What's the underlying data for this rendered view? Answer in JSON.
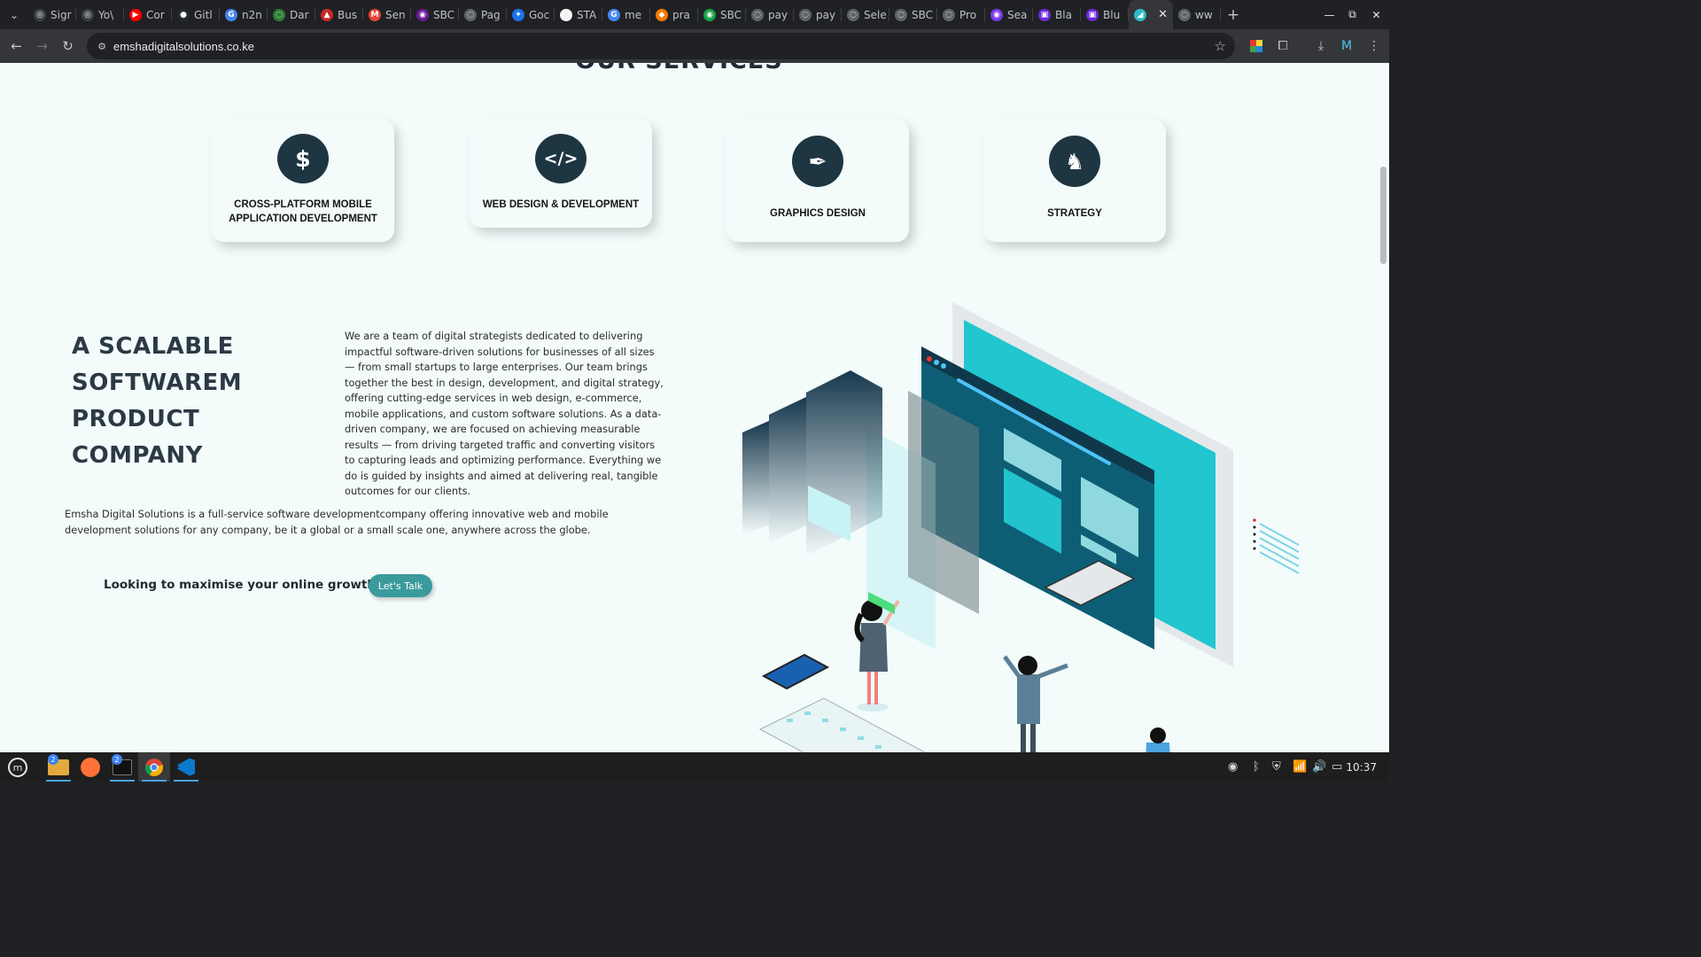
{
  "browser": {
    "tabs": [
      {
        "label": "Sigr",
        "icon": "chatgpt-icon",
        "color": "#3c4043",
        "glyph": "◎"
      },
      {
        "label": "Yo\\",
        "icon": "openai-icon",
        "color": "#3c4043",
        "glyph": "◎"
      },
      {
        "label": "Cor",
        "icon": "youtube-icon",
        "color": "#ff0000",
        "glyph": "▶"
      },
      {
        "label": "Gitl",
        "icon": "github-icon",
        "color": "#24292e",
        "glyph": "●"
      },
      {
        "label": "n2n",
        "icon": "google-icon",
        "color": "#4285f4",
        "glyph": "G"
      },
      {
        "label": "Dar",
        "icon": "daraja-icon",
        "color": "#2e7d32",
        "glyph": "◌"
      },
      {
        "label": "Bus",
        "icon": "business-icon",
        "color": "#c62828",
        "glyph": "▲"
      },
      {
        "label": "Sen",
        "icon": "gmail-icon",
        "color": "#ea4335",
        "glyph": "M"
      },
      {
        "label": "SBC",
        "icon": "sbc-icon",
        "color": "#6a1b9a",
        "glyph": "◉"
      },
      {
        "label": "Pag",
        "icon": "globe-icon",
        "color": "#5f6368",
        "glyph": "◌"
      },
      {
        "label": "Goc",
        "icon": "gemini-icon",
        "color": "#1a73e8",
        "glyph": "✦"
      },
      {
        "label": "STA",
        "icon": "sta-icon",
        "color": "#f5f5f5",
        "glyph": "◌"
      },
      {
        "label": "me",
        "icon": "google-icon",
        "color": "#4285f4",
        "glyph": "G"
      },
      {
        "label": "pra",
        "icon": "brave-icon",
        "color": "#f57c00",
        "glyph": "◆"
      },
      {
        "label": "SBC",
        "icon": "sbc-green-icon",
        "color": "#16a34a",
        "glyph": "◉"
      },
      {
        "label": "pay",
        "icon": "globe-icon",
        "color": "#5f6368",
        "glyph": "◌"
      },
      {
        "label": "pay",
        "icon": "globe-icon",
        "color": "#5f6368",
        "glyph": "◌"
      },
      {
        "label": "Sele",
        "icon": "globe-icon",
        "color": "#5f6368",
        "glyph": "◌"
      },
      {
        "label": "SBC",
        "icon": "globe-icon",
        "color": "#5f6368",
        "glyph": "◌"
      },
      {
        "label": "Pro",
        "icon": "globe-icon",
        "color": "#5f6368",
        "glyph": "◌"
      },
      {
        "label": "Sea",
        "icon": "copilot-icon",
        "color": "#7c3aed",
        "glyph": "◉"
      },
      {
        "label": "Bla",
        "icon": "blackbox-icon",
        "color": "#6d28d9",
        "glyph": "▣"
      },
      {
        "label": "Blu",
        "icon": "blackbox-icon",
        "color": "#6d28d9",
        "glyph": "▣"
      },
      {
        "label": "",
        "icon": "emsha-icon",
        "color": "#2bbbc9",
        "glyph": "◢",
        "active": true
      },
      {
        "label": "ww",
        "icon": "globe-icon",
        "color": "#5f6368",
        "glyph": "◌"
      }
    ],
    "url": "emshadigitalsolutions.co.ke"
  },
  "page": {
    "services_title": "OUR SERVICES",
    "services": [
      {
        "label": "CROSS-PLATFORM MOBILE APPLICATION DEVELOPMENT",
        "icon": "dollar-icon",
        "glyph": "$"
      },
      {
        "label": "WEB DESIGN & DEVELOPMENT",
        "icon": "code-icon",
        "glyph": "</>"
      },
      {
        "label": "GRAPHICS DESIGN",
        "icon": "pen-nib-icon",
        "glyph": "✒"
      },
      {
        "label": "STRATEGY",
        "icon": "chess-knight-icon",
        "glyph": "♞"
      }
    ],
    "headline": [
      "A SCALABLE",
      "SOFTWAREM",
      "PRODUCT",
      "COMPANY"
    ],
    "about": "We are a team of digital strategists dedicated to delivering impactful software-driven solutions for businesses of all sizes — from small startups to large enterprises. Our team brings together the best in design, development, and digital strategy, offering cutting-edge services in web design, e-commerce, mobile applications, and custom software solutions. As a data-driven company, we are focused on achieving measurable results — from driving targeted traffic and converting visitors to capturing leads and optimizing performance. Everything we do is guided by insights and aimed at delivering real, tangible outcomes for our clients.",
    "company": "Emsha Digital Solutions is a full-service software developmentcompany offering innovative web and mobile development solutions for any company, be it a global or a small scale one, anywhere across the globe.",
    "growth_prompt": "Looking to maximise your online growth?",
    "cta_label": "Let's Talk"
  },
  "taskbar": {
    "clock": "10:37",
    "files_badge": "2",
    "terminal_badge": "2"
  },
  "colors": {
    "page_bg": "#f3fbfb",
    "icon_circle": "#1e3542",
    "cta": "#3a9a9c",
    "accent_teal": "#2bbbc9"
  }
}
